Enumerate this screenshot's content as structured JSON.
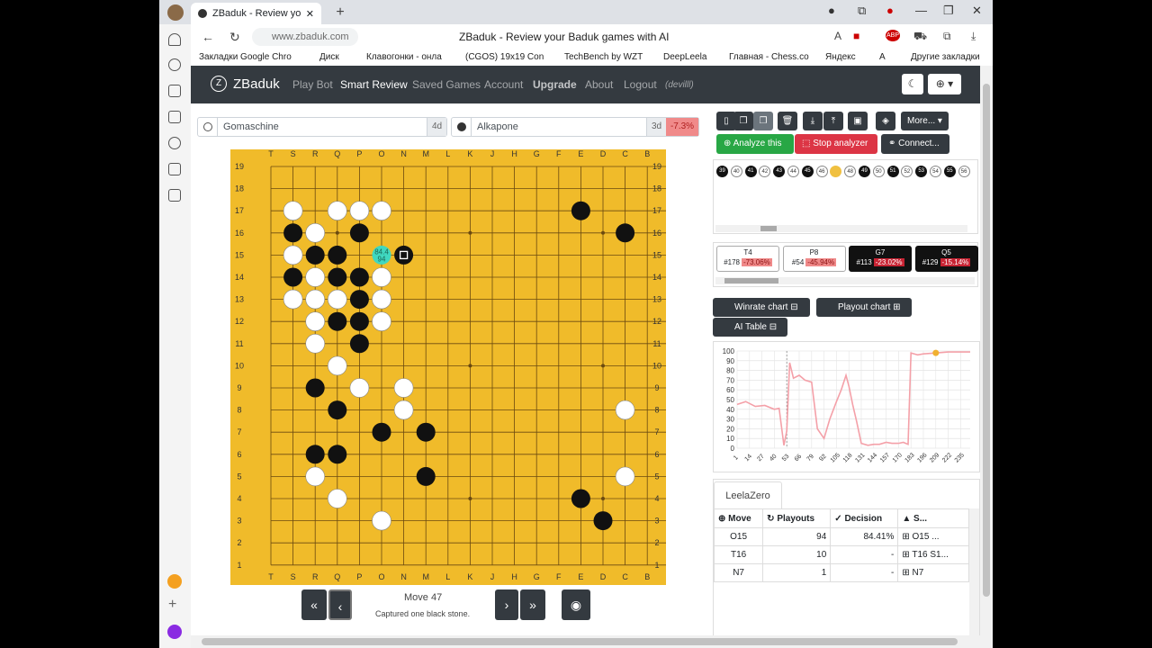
{
  "browser": {
    "tab_title": "ZBaduk - Review your Ba...",
    "url": "www.zbaduk.com",
    "page_title": "ZBaduk - Review your Baduk games with AI",
    "bookmarks": [
      "Закладки Google Chro",
      "Диск",
      "Клавогонки - онла",
      "(CGOS) 19x19 Con",
      "TechBench by WZT",
      "DeepLeela",
      "Главная - Chess.co",
      "Яндекс",
      "А",
      "Другие закладки"
    ],
    "ext_abp": "ABP"
  },
  "nav": {
    "brand": "ZBaduk",
    "links": [
      "Play Bot",
      "Smart Review",
      "Saved Games",
      "Account",
      "Upgrade",
      "About",
      "Logout"
    ],
    "user": "(devilll)"
  },
  "players": {
    "white": {
      "name": "Gomaschine",
      "rank": "4d"
    },
    "black": {
      "name": "Alkapone",
      "rank": "3d",
      "delta": "-7.3%"
    }
  },
  "board": {
    "columns": [
      "T",
      "S",
      "R",
      "Q",
      "P",
      "O",
      "N",
      "M",
      "L",
      "K",
      "J",
      "H",
      "G",
      "F",
      "E",
      "D",
      "C",
      "B",
      "A"
    ],
    "rows": [
      "19",
      "18",
      "17",
      "16",
      "15",
      "14",
      "13",
      "12",
      "11",
      "10",
      "9",
      "8",
      "7",
      "6",
      "5",
      "4",
      "3",
      "2",
      "1"
    ],
    "black_stones": [
      "E17",
      "C16",
      "S16",
      "P16",
      "R15",
      "Q15",
      "S14",
      "Q14",
      "P14",
      "P13",
      "Q12",
      "P12",
      "P11",
      "R9",
      "Q8",
      "O7",
      "M7",
      "R6",
      "Q6",
      "M5",
      "E4",
      "D3"
    ],
    "white_stones": [
      "S17",
      "Q17",
      "P17",
      "O17",
      "R16",
      "S15",
      "R14",
      "O14",
      "S13",
      "R13",
      "Q13",
      "O13",
      "R12",
      "O12",
      "R11",
      "Q10",
      "P9",
      "N9",
      "N8",
      "C8",
      "R5",
      "C5",
      "Q4",
      "O3"
    ],
    "last_move": "N15",
    "suggestion": {
      "point": "O15",
      "winrate": "84.4",
      "playouts": "94"
    }
  },
  "move": {
    "label": "Move 47",
    "sub": "Captured one black stone."
  },
  "toolbar": {
    "more": "More...",
    "analyze": "Analyze this",
    "stop": "Stop analyzer",
    "connect": "Connect..."
  },
  "timeline": [
    {
      "n": "39",
      "c": "b"
    },
    {
      "n": "40",
      "c": "w"
    },
    {
      "n": "41",
      "c": "b"
    },
    {
      "n": "42",
      "c": "w"
    },
    {
      "n": "43",
      "c": "b"
    },
    {
      "n": "44",
      "c": "w"
    },
    {
      "n": "45",
      "c": "b"
    },
    {
      "n": "46",
      "c": "w"
    },
    {
      "n": "47",
      "c": "y"
    },
    {
      "n": "48",
      "c": "w"
    },
    {
      "n": "49",
      "c": "b"
    },
    {
      "n": "50",
      "c": "w"
    },
    {
      "n": "51",
      "c": "b"
    },
    {
      "n": "52",
      "c": "w"
    },
    {
      "n": "53",
      "c": "b"
    },
    {
      "n": "54",
      "c": "w"
    },
    {
      "n": "55",
      "c": "b"
    },
    {
      "n": "56",
      "c": "w"
    }
  ],
  "mistakes": [
    {
      "move": "T4",
      "num": "#178",
      "pct": "-73.06%",
      "dark": false
    },
    {
      "move": "P8",
      "num": "#54",
      "pct": "-45.94%",
      "dark": false
    },
    {
      "move": "G7",
      "num": "#113",
      "pct": "-23.02%",
      "dark": true
    },
    {
      "move": "Q5",
      "num": "#129",
      "pct": "-15.14%",
      "dark": true
    }
  ],
  "chart_buttons": {
    "winrate": "Winrate chart",
    "playout": "Playout chart",
    "aitable": "AI Table"
  },
  "chart_data": {
    "type": "line",
    "title": "",
    "xlabel": "",
    "ylabel": "",
    "ylim": [
      0,
      100
    ],
    "x_ticks": [
      "1",
      "14",
      "27",
      "40",
      "53",
      "66",
      "79",
      "92",
      "105",
      "118",
      "131",
      "144",
      "157",
      "170",
      "183",
      "196",
      "209",
      "222",
      "235"
    ],
    "y_ticks": [
      "0",
      "10",
      "20",
      "30",
      "40",
      "50",
      "60",
      "70",
      "80",
      "90",
      "100"
    ],
    "x": [
      1,
      10,
      20,
      30,
      40,
      45,
      50,
      53,
      56,
      60,
      66,
      72,
      79,
      85,
      92,
      98,
      105,
      110,
      115,
      118,
      122,
      126,
      131,
      138,
      144,
      150,
      157,
      163,
      170,
      175,
      180,
      183,
      190,
      196,
      209,
      222,
      235,
      245
    ],
    "values": [
      45,
      48,
      43,
      44,
      40,
      41,
      3,
      18,
      88,
      72,
      75,
      70,
      68,
      20,
      10,
      30,
      48,
      60,
      75,
      64,
      45,
      28,
      5,
      3,
      4,
      4,
      6,
      5,
      5,
      6,
      4,
      98,
      96,
      97,
      98,
      99,
      99,
      99
    ],
    "current_move": 209
  },
  "ai": {
    "engine": "LeelaZero",
    "headers": [
      "Move",
      "Playouts",
      "Decision",
      "S..."
    ],
    "rows": [
      {
        "move": "O15",
        "playouts": "94",
        "decision": "84.41%",
        "seq": "O15 ..."
      },
      {
        "move": "T16",
        "playouts": "10",
        "decision": "-",
        "seq": "T16 S1..."
      },
      {
        "move": "N7",
        "playouts": "1",
        "decision": "-",
        "seq": "N7"
      }
    ]
  }
}
